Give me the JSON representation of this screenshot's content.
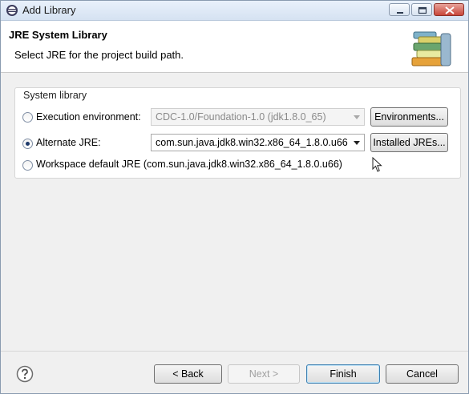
{
  "window": {
    "title": "Add Library"
  },
  "header": {
    "title": "JRE System Library",
    "description": "Select JRE for the project build path."
  },
  "system_library": {
    "group_label": "System library",
    "execution_environment": {
      "label": "Execution environment:",
      "value": "CDC-1.0/Foundation-1.0 (jdk1.8.0_65)",
      "button": "Environments...",
      "selected": false,
      "enabled": false
    },
    "alternate_jre": {
      "label": "Alternate JRE:",
      "value": "com.sun.java.jdk8.win32.x86_64_1.8.0.u66",
      "button": "Installed JREs...",
      "selected": true
    },
    "workspace_default": {
      "label": "Workspace default JRE (com.sun.java.jdk8.win32.x86_64_1.8.0.u66)",
      "selected": false
    }
  },
  "footer": {
    "back": "< Back",
    "next": "Next >",
    "finish": "Finish",
    "cancel": "Cancel"
  },
  "icons": [
    "eclipse-icon",
    "minimize-icon",
    "maximize-icon",
    "close-icon",
    "library-books-icon",
    "help-icon",
    "mouse-cursor-icon"
  ]
}
